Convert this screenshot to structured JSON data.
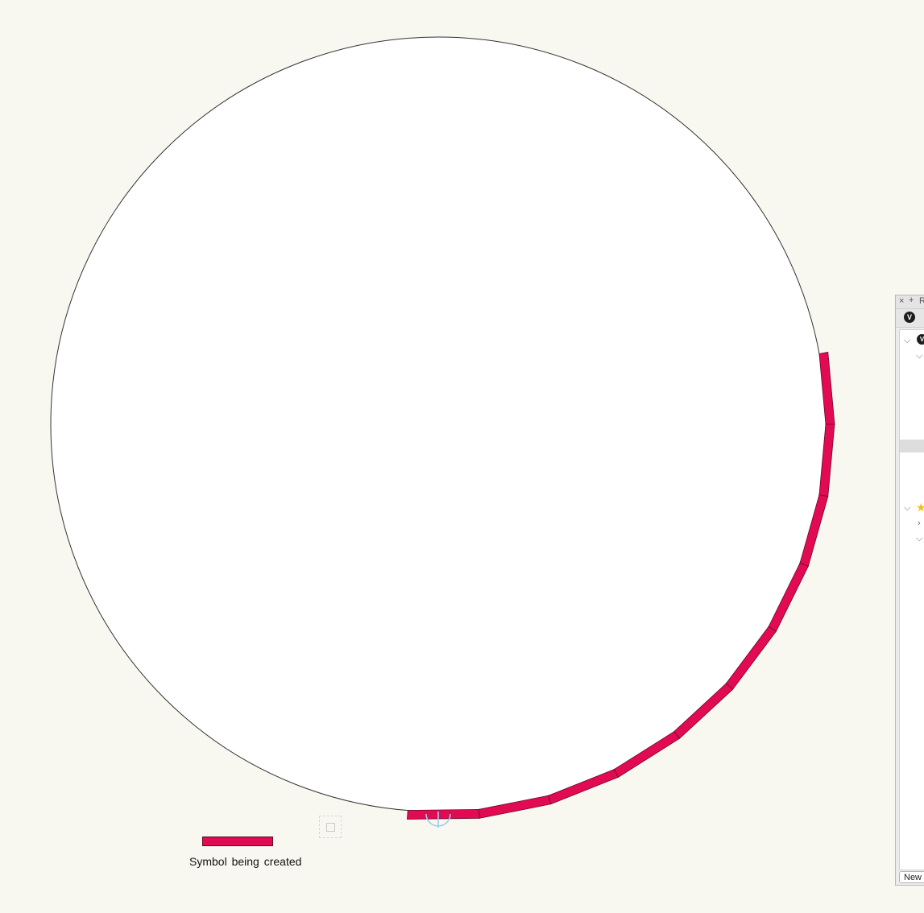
{
  "drawing": {
    "legend_label": "Symbol being created",
    "highlight_color": "#e20a52",
    "circle_fill": "#ffffff",
    "background": "#f9f8f0",
    "snap_icon": "snap-square-icon",
    "insertion_icon": "insertion-point-crosshair-icon"
  },
  "palette": {
    "title": "R",
    "close_glyph": "×",
    "add_glyph": "+",
    "app_icon_glyph": "V",
    "new_button_label": "New"
  }
}
